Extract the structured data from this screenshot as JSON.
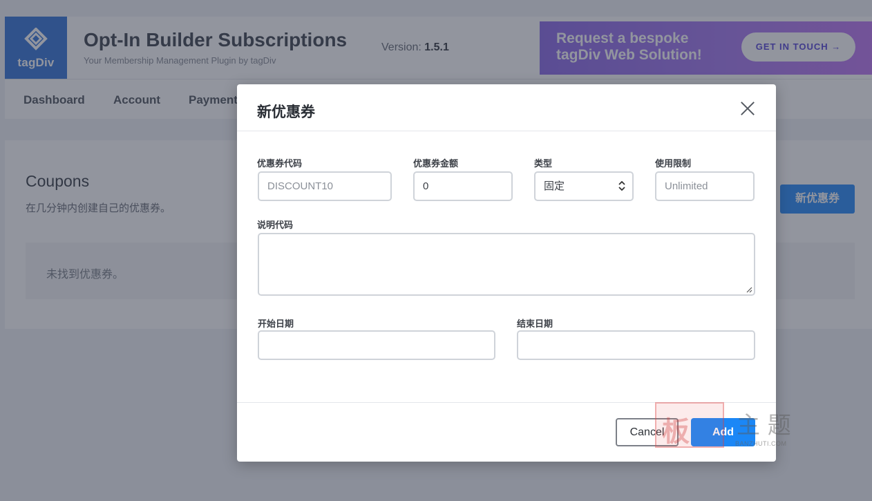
{
  "header": {
    "logo_text": "tagDiv",
    "app_title": "Opt-In Builder Subscriptions",
    "app_subtitle": "Your Membership Management Plugin by tagDiv",
    "version_label": "Version:",
    "version_value": "1.5.1",
    "banner_line1": "Request a bespoke",
    "banner_line2": "tagDiv Web Solution!",
    "banner_button": "GET IN TOUCH →"
  },
  "nav": {
    "items": [
      {
        "label": "Dashboard"
      },
      {
        "label": "Account"
      },
      {
        "label": "Payment"
      }
    ]
  },
  "coupons_panel": {
    "title": "Coupons",
    "subtitle": "在几分钟内创建自己的优惠券。",
    "new_button": "新优惠券",
    "empty_message": "未找到优惠券。"
  },
  "modal": {
    "title": "新优惠券",
    "fields": {
      "code": {
        "label": "优惠券代码",
        "placeholder": "DISCOUNT10"
      },
      "amount": {
        "label": "优惠券金额",
        "value": "0"
      },
      "type": {
        "label": "类型",
        "value": "固定"
      },
      "limit": {
        "label": "使用限制",
        "placeholder": "Unlimited"
      },
      "description": {
        "label": "说明代码",
        "value": ""
      },
      "start_date": {
        "label": "开始日期",
        "value": ""
      },
      "end_date": {
        "label": "结束日期",
        "value": ""
      }
    },
    "cancel_button": "Cancel",
    "add_button": "Add"
  },
  "watermark": {
    "seal": "板",
    "script": "主 题",
    "url": "BANZHUTI.COM"
  },
  "colors": {
    "primary": "#1b87f6",
    "logo_bg": "#3a78d8",
    "banner_start": "#8f6ee9",
    "banner_end": "#c07bf2"
  }
}
